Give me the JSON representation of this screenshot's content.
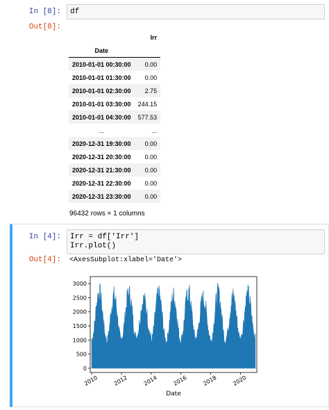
{
  "cell8": {
    "in_prompt": "In [8]:",
    "code": "df",
    "out_prompt": "Out[8]:"
  },
  "dataframe": {
    "column": "Irr",
    "index_name": "Date",
    "rows": [
      {
        "date": "2010-01-01 00:30:00",
        "irr": "0.00"
      },
      {
        "date": "2010-01-01 01:30:00",
        "irr": "0.00"
      },
      {
        "date": "2010-01-01 02:30:00",
        "irr": "2.75"
      },
      {
        "date": "2010-01-01 03:30:00",
        "irr": "244.15"
      },
      {
        "date": "2010-01-01 04:30:00",
        "irr": "577.53"
      },
      {
        "date": "...",
        "irr": "..."
      },
      {
        "date": "2020-12-31 19:30:00",
        "irr": "0.00"
      },
      {
        "date": "2020-12-31 20:30:00",
        "irr": "0.00"
      },
      {
        "date": "2020-12-31 21:30:00",
        "irr": "0.00"
      },
      {
        "date": "2020-12-31 22:30:00",
        "irr": "0.00"
      },
      {
        "date": "2020-12-31 23:30:00",
        "irr": "0.00"
      }
    ],
    "shape_text": "96432 rows × 1 columns"
  },
  "cell4": {
    "in_prompt": "In [4]:",
    "code": "Irr = df['Irr']\nIrr.plot()",
    "out_prompt": "Out[4]:",
    "repr": "<AxesSubplot:xlabel='Date'>"
  },
  "colors": {
    "series": "#1f77b4",
    "in_prompt": "#303f9f",
    "out_prompt": "#d84315",
    "selected_border": "#42a5f5"
  },
  "chart_data": {
    "type": "area",
    "xlabel": "Date",
    "ylabel": "",
    "x_ticks": [
      "2010",
      "2012",
      "2014",
      "2016",
      "2018",
      "2020"
    ],
    "y_ticks": [
      0,
      500,
      1000,
      1500,
      2000,
      2500,
      3000
    ],
    "xlim": [
      2009.9,
      2021.1
    ],
    "ylim": [
      -150,
      3250
    ],
    "series": [
      {
        "years": [
          2010,
          2011,
          2012,
          2013,
          2014,
          2015,
          2016,
          2017,
          2018,
          2019,
          2020
        ],
        "summer_peak": [
          3100,
          2950,
          3050,
          2800,
          3000,
          2950,
          3100,
          2850,
          3050,
          2900,
          3000
        ],
        "winter_trough": [
          1200,
          1100,
          1250,
          1300,
          1150,
          1100,
          1200,
          1250,
          1100,
          1200,
          1250
        ]
      }
    ],
    "grid": false
  }
}
